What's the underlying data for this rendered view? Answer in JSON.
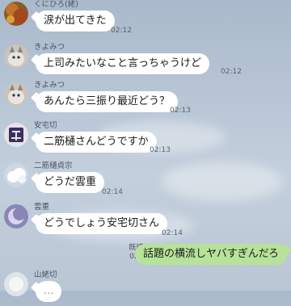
{
  "messages": [
    {
      "sender": "くにひろ(姥)",
      "text": "涙が出てきた",
      "time": "02:12",
      "avatar_icon": "autumn-leaves-avatar-icon"
    },
    {
      "sender": "きよみつ",
      "text": "上司みたいなこと言っちゃうけど",
      "time": "02:12",
      "avatar_icon": "cat-avatar-icon"
    },
    {
      "sender": "きよみつ",
      "text": "あんたら三振り最近どう？",
      "time": "02:13",
      "avatar_icon": "cat-avatar-icon"
    },
    {
      "sender": "安宅切",
      "text": "二筋樋さんどうですか",
      "time": "02:13",
      "avatar_icon": "kanji-crest-avatar-icon"
    },
    {
      "sender": "二筋樋貞宗",
      "text": "どうだ雲重",
      "time": "02:14",
      "avatar_icon": "cloud-avatar-icon"
    },
    {
      "sender": "雲重",
      "text": "どうでしょう安宅切さん",
      "time": "02:14",
      "avatar_icon": "moon-avatar-icon"
    },
    {
      "sender": "山姥切",
      "text": "...",
      "time": "",
      "avatar_icon": "blur-avatar-icon"
    }
  ],
  "outgoing": {
    "text": "話題の横流しヤバすぎんだろ",
    "read_label": "既読 8",
    "time": "02:14"
  },
  "colors": {
    "incoming_bubble": "#ffffff",
    "outgoing_bubble": "#b7e29a",
    "background": "#b6c4d4"
  }
}
